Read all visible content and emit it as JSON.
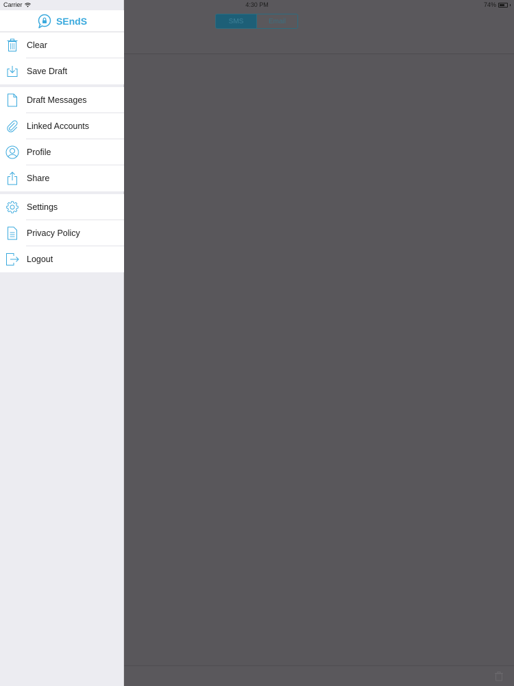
{
  "status_bar": {
    "carrier": "Carrier",
    "time": "4:30 PM",
    "battery_percent": "74%",
    "battery_level": 0.74
  },
  "app": {
    "title": "SEndS",
    "accent_color": "#3aa9dd"
  },
  "segmented_control": {
    "options": [
      "SMS",
      "Email"
    ],
    "selected": "SMS"
  },
  "menu": {
    "group1": [
      {
        "label": "Clear",
        "icon": "trash-icon"
      },
      {
        "label": "Save Draft",
        "icon": "save-draft-icon"
      }
    ],
    "group2": [
      {
        "label": "Draft Messages",
        "icon": "document-icon"
      },
      {
        "label": "Linked Accounts",
        "icon": "paperclip-icon"
      },
      {
        "label": "Profile",
        "icon": "profile-icon"
      },
      {
        "label": "Share",
        "icon": "share-icon"
      }
    ],
    "group3": [
      {
        "label": "Settings",
        "icon": "gear-icon"
      },
      {
        "label": "Privacy Policy",
        "icon": "policy-document-icon"
      },
      {
        "label": "Logout",
        "icon": "logout-icon"
      }
    ]
  }
}
